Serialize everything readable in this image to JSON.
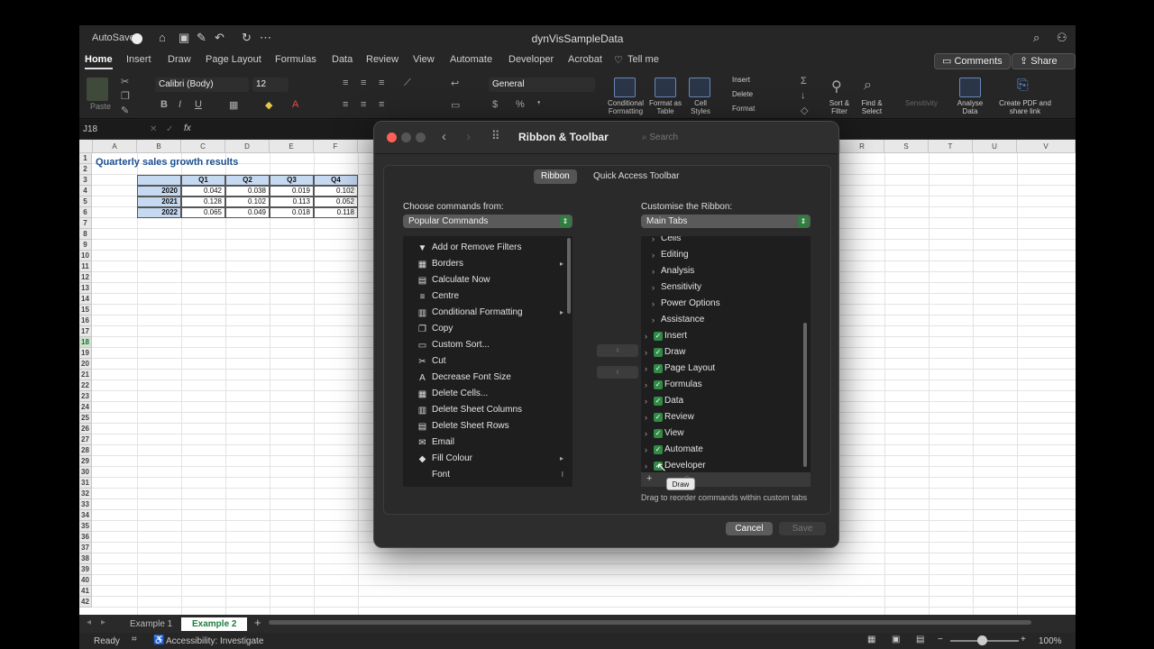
{
  "window": {
    "autosave_label": "AutoSave",
    "doc_title": "dynVisSampleData"
  },
  "tabs": [
    "Home",
    "Insert",
    "Draw",
    "Page Layout",
    "Formulas",
    "Data",
    "Review",
    "View",
    "Automate",
    "Developer",
    "Acrobat",
    "Tell me"
  ],
  "header_buttons": {
    "comments": "Comments",
    "share": "Share"
  },
  "ribbon": {
    "paste_label": "Paste",
    "font_name": "Calibri (Body)",
    "font_size": "12",
    "number_format": "General",
    "conditional_formatting": "Conditional Formatting",
    "format_as_table": "Format as Table",
    "cell_styles": "Cell Styles",
    "insert": "Insert",
    "delete": "Delete",
    "format": "Format",
    "sort_filter": "Sort & Filter",
    "find_select": "Find & Select",
    "sensitivity": "Sensitivity",
    "analyse_data": "Analyse Data",
    "create_pdf": "Create PDF and share link"
  },
  "formula_bar": {
    "name_box": "J18",
    "fx": "fx"
  },
  "grid": {
    "columns": [
      "A",
      "B",
      "C",
      "D",
      "E",
      "F",
      "R",
      "S",
      "T",
      "U",
      "V"
    ],
    "rows": [
      "1",
      "2",
      "3",
      "4",
      "5",
      "6",
      "7",
      "8",
      "9",
      "10",
      "11",
      "12",
      "13",
      "14",
      "15",
      "16",
      "17",
      "18",
      "19",
      "20",
      "21",
      "22",
      "23",
      "24",
      "25",
      "26",
      "27",
      "28",
      "29",
      "30",
      "31",
      "32",
      "33",
      "34",
      "35",
      "36",
      "37",
      "38",
      "39",
      "40",
      "41",
      "42"
    ],
    "selected_row": "18",
    "title": "Quarterly sales growth results",
    "table": {
      "headers": [
        "Q1",
        "Q2",
        "Q3",
        "Q4"
      ],
      "rows": [
        {
          "year": "2020",
          "values": [
            "0.042",
            "0.038",
            "0.019",
            "0.102"
          ]
        },
        {
          "year": "2021",
          "values": [
            "0.128",
            "0.102",
            "0.113",
            "0.052"
          ]
        },
        {
          "year": "2022",
          "values": [
            "0.065",
            "0.049",
            "0.018",
            "0.118"
          ]
        }
      ]
    }
  },
  "sheet_tabs": [
    "Example 1",
    "Example 2"
  ],
  "active_sheet": "Example 2",
  "status": {
    "ready": "Ready",
    "accessibility": "Accessibility: Investigate",
    "zoom": "100%"
  },
  "dialog": {
    "title": "Ribbon & Toolbar",
    "search_placeholder": "Search",
    "segments": [
      "Ribbon",
      "Quick Access Toolbar"
    ],
    "choose_label": "Choose commands from:",
    "choose_value": "Popular Commands",
    "customise_label": "Customise the Ribbon:",
    "customise_value": "Main Tabs",
    "commands": [
      {
        "label": "Add or Remove Filters",
        "icon": "filter-icon",
        "glyph": "▼",
        "sub": ""
      },
      {
        "label": "Borders",
        "icon": "borders-icon",
        "glyph": "▦",
        "sub": "▸"
      },
      {
        "label": "Calculate Now",
        "icon": "calculator-icon",
        "glyph": "▤",
        "sub": ""
      },
      {
        "label": "Centre",
        "icon": "align-center-icon",
        "glyph": "≡",
        "sub": ""
      },
      {
        "label": "Conditional Formatting",
        "icon": "conditional-formatting-icon",
        "glyph": "▥",
        "sub": "▸"
      },
      {
        "label": "Copy",
        "icon": "copy-icon",
        "glyph": "❐",
        "sub": ""
      },
      {
        "label": "Custom Sort...",
        "icon": "sort-icon",
        "glyph": "▭",
        "sub": ""
      },
      {
        "label": "Cut",
        "icon": "scissors-icon",
        "glyph": "✂",
        "sub": ""
      },
      {
        "label": "Decrease Font Size",
        "icon": "decrease-font-icon",
        "glyph": "A",
        "sub": ""
      },
      {
        "label": "Delete Cells...",
        "icon": "delete-cells-icon",
        "glyph": "▦",
        "sub": ""
      },
      {
        "label": "Delete Sheet Columns",
        "icon": "delete-columns-icon",
        "glyph": "▥",
        "sub": ""
      },
      {
        "label": "Delete Sheet Rows",
        "icon": "delete-rows-icon",
        "glyph": "▤",
        "sub": ""
      },
      {
        "label": "Email",
        "icon": "email-icon",
        "glyph": "✉",
        "sub": ""
      },
      {
        "label": "Fill Colour",
        "icon": "fill-colour-icon",
        "glyph": "◆",
        "sub": "▸"
      },
      {
        "label": "Font",
        "icon": "font-icon",
        "glyph": "",
        "sub": "I"
      }
    ],
    "ribbon_items": [
      {
        "label": "Cells",
        "level": 2,
        "checked": false
      },
      {
        "label": "Editing",
        "level": 2,
        "checked": false
      },
      {
        "label": "Analysis",
        "level": 2,
        "checked": false
      },
      {
        "label": "Sensitivity",
        "level": 2,
        "checked": false
      },
      {
        "label": "Power Options",
        "level": 2,
        "checked": false
      },
      {
        "label": "Assistance",
        "level": 2,
        "checked": false
      },
      {
        "label": "Insert",
        "level": 1,
        "checked": true
      },
      {
        "label": "Draw",
        "level": 1,
        "checked": true
      },
      {
        "label": "Page Layout",
        "level": 1,
        "checked": true
      },
      {
        "label": "Formulas",
        "level": 1,
        "checked": true
      },
      {
        "label": "Data",
        "level": 1,
        "checked": true
      },
      {
        "label": "Review",
        "level": 1,
        "checked": true
      },
      {
        "label": "View",
        "level": 1,
        "checked": true
      },
      {
        "label": "Automate",
        "level": 1,
        "checked": true
      },
      {
        "label": "Developer",
        "level": 1,
        "checked": true
      }
    ],
    "drag_hint": "Drag to reorder commands within custom tabs",
    "tooltip": "Draw",
    "cancel": "Cancel",
    "save": "Save"
  }
}
